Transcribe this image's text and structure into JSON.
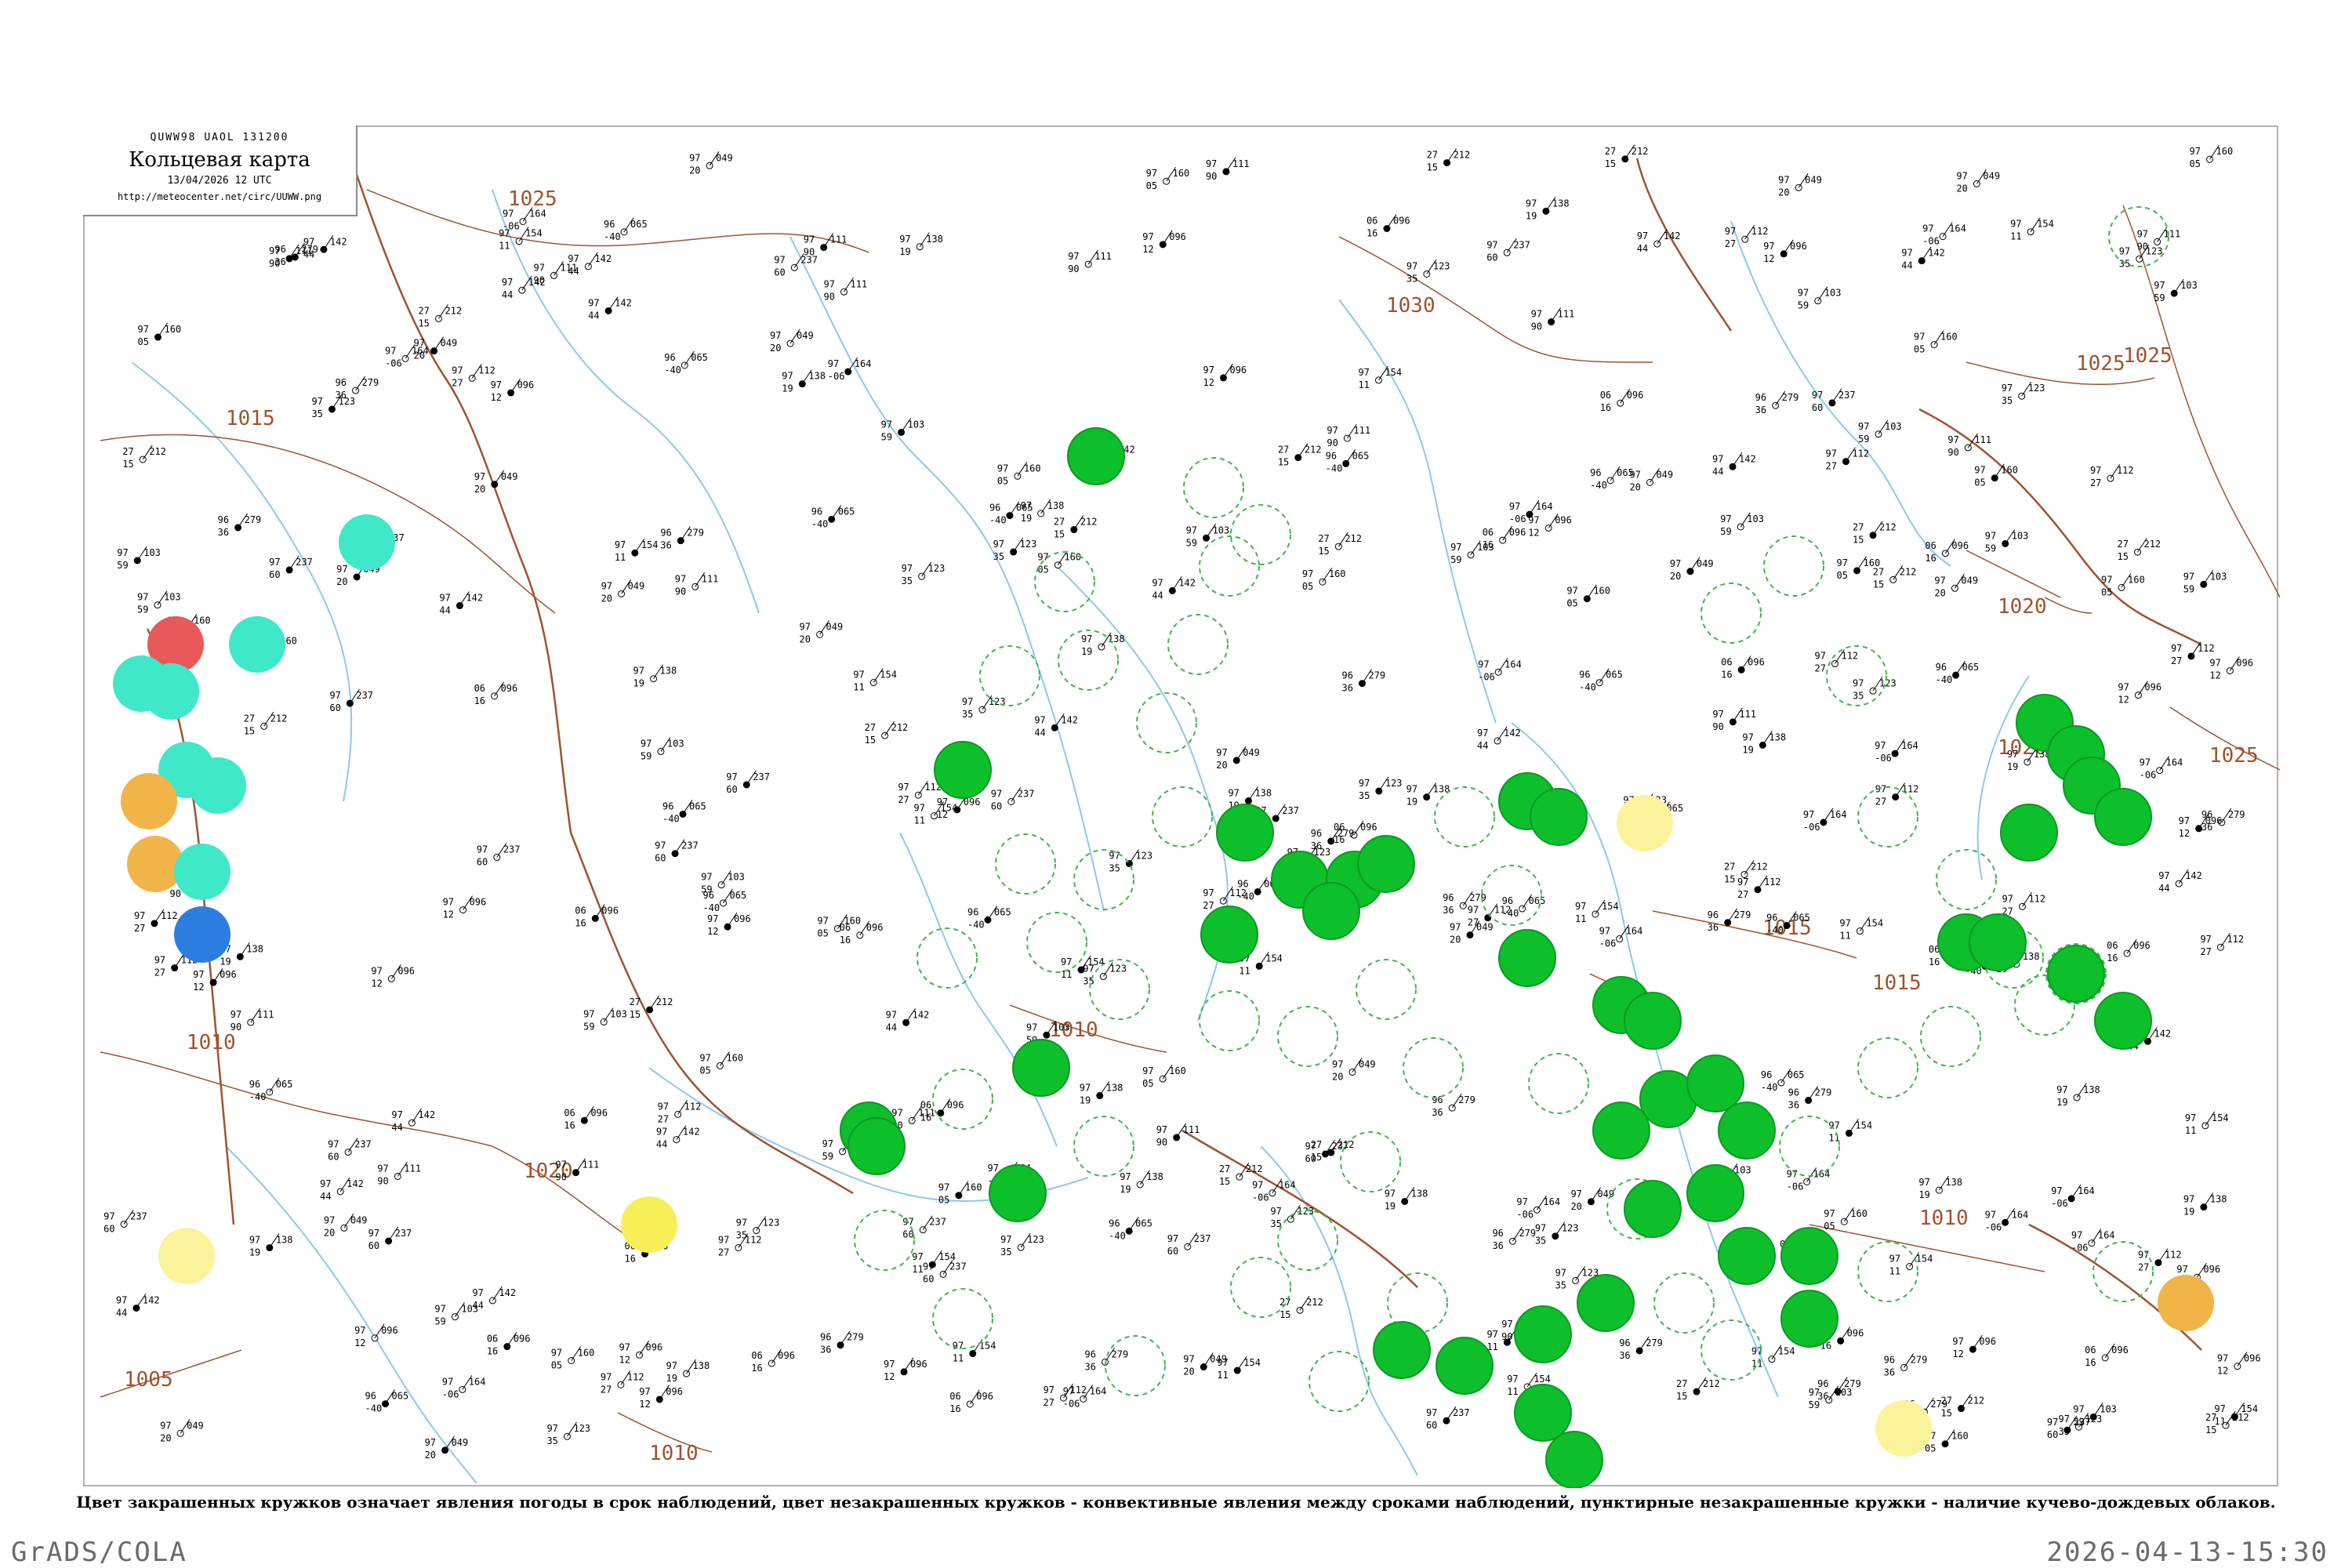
{
  "header": {
    "code": "QUWW98  UAOL  131200",
    "title": "Кольцевая карта",
    "date": "13/04/2026 12 UTC",
    "url": "http://meteocenter.net/circ/UUWW.png"
  },
  "isobars": [
    "1025",
    "1015",
    "1010",
    "1005",
    "1030",
    "1020",
    "1025",
    "1015",
    "1010",
    "1020",
    "1025",
    "1010",
    "1015",
    "1020",
    "1025",
    "1010"
  ],
  "legend_note": "Цвет закрашенных кружков означает явления погоды в срок наблюдений, цвет незакрашенных кружков - конвективные явления между сроками наблюдений, пунктирные незакрашенные кружки - наличие кучево-дождевых облаков.",
  "footer": {
    "left": "GrADS/COLA",
    "right": "2026-04-13-15:30"
  },
  "colors": {
    "precip_fill": "#0dbf2b",
    "precip_dashed": "#3cb84a",
    "fog_red": "#e85a5a",
    "cyan": "#3fe8c8",
    "orange": "#f0b448",
    "yellow": "#f6ef57",
    "pale_yellow": "#faf39a",
    "blue": "#2a7ee0",
    "isobar": "#a0522d",
    "river": "#8cc8f0",
    "border": "#a0522d"
  },
  "stations": [
    {
      "pressure": "164",
      "temp": "97",
      "dew": "-06"
    },
    {
      "pressure": "112",
      "temp": "97",
      "dew": "27"
    },
    {
      "pressure": "096",
      "temp": "06",
      "dew": "16"
    },
    {
      "pressure": "065",
      "temp": "96",
      "dew": "-40"
    },
    {
      "pressure": "212",
      "temp": "27",
      "dew": "15"
    },
    {
      "pressure": "123",
      "temp": "97",
      "dew": "35"
    },
    {
      "pressure": "279",
      "temp": "96",
      "dew": "36"
    },
    {
      "pressure": "160",
      "temp": "97",
      "dew": "05"
    },
    {
      "pressure": "138",
      "temp": "97",
      "dew": "19"
    },
    {
      "pressure": "111",
      "temp": "97",
      "dew": "90"
    },
    {
      "pressure": "096",
      "temp": "97",
      "dew": "12"
    },
    {
      "pressure": "142",
      "temp": "97",
      "dew": "44"
    },
    {
      "pressure": "103",
      "temp": "97",
      "dew": "59"
    },
    {
      "pressure": "049",
      "temp": "97",
      "dew": "20"
    },
    {
      "pressure": "154",
      "temp": "97",
      "dew": "11"
    },
    {
      "pressure": "237",
      "temp": "97",
      "dew": "60"
    }
  ]
}
